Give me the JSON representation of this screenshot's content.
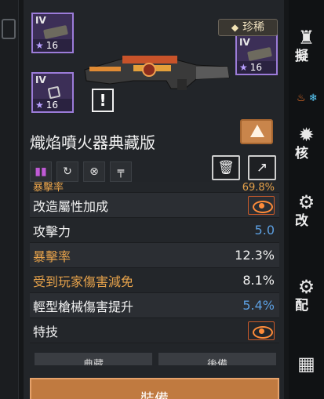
{
  "weapon": {
    "name": "熾焰噴火器典藏版",
    "rarity": "珍稀",
    "alert": "!"
  },
  "mod_slots": [
    {
      "tier": "IV",
      "level": "16"
    },
    {
      "tier": "IV",
      "level": "16"
    },
    {
      "tier": "IV",
      "level": "16"
    }
  ],
  "stats": {
    "partial_row": {
      "label": "暴擊率",
      "value": "69.8%"
    },
    "modify_bonus": "改造屬性加成",
    "rows": [
      {
        "label": "攻擊力",
        "value": "5.0"
      },
      {
        "label": "暴擊率",
        "value": "12.3%"
      },
      {
        "label": "受到玩家傷害減免",
        "value": "8.1%"
      },
      {
        "label": "輕型槍械傷害提升",
        "value": "5.4%"
      }
    ],
    "skill": "特技"
  },
  "tabs": [
    "典藏",
    "後備"
  ],
  "equip_label": "裝備",
  "right_strip": {
    "labels": [
      "擬",
      "核",
      "改",
      "配"
    ]
  },
  "colors": {
    "accent_orange": "#e6a24b",
    "value_blue": "#5c9fe1",
    "slot_purple": "#9c7cd9",
    "equip_button": "#c07a40"
  }
}
